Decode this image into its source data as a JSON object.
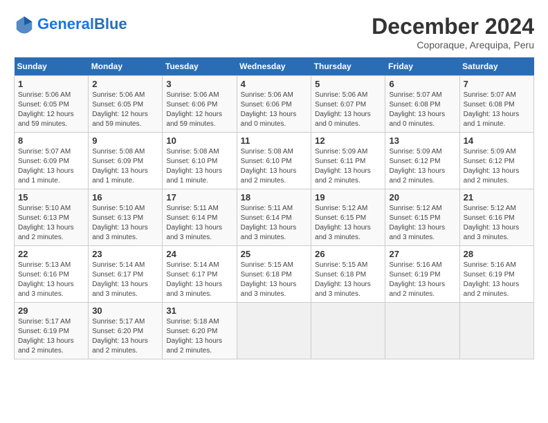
{
  "header": {
    "logo_general": "General",
    "logo_blue": "Blue",
    "month_title": "December 2024",
    "location": "Coporaque, Arequipa, Peru"
  },
  "calendar": {
    "days_of_week": [
      "Sunday",
      "Monday",
      "Tuesday",
      "Wednesday",
      "Thursday",
      "Friday",
      "Saturday"
    ],
    "weeks": [
      [
        {
          "num": "",
          "info": ""
        },
        {
          "num": "2",
          "info": "Sunrise: 5:06 AM\nSunset: 6:05 PM\nDaylight: 12 hours and 59 minutes."
        },
        {
          "num": "3",
          "info": "Sunrise: 5:06 AM\nSunset: 6:06 PM\nDaylight: 12 hours and 59 minutes."
        },
        {
          "num": "4",
          "info": "Sunrise: 5:06 AM\nSunset: 6:06 PM\nDaylight: 13 hours and 0 minutes."
        },
        {
          "num": "5",
          "info": "Sunrise: 5:06 AM\nSunset: 6:07 PM\nDaylight: 13 hours and 0 minutes."
        },
        {
          "num": "6",
          "info": "Sunrise: 5:07 AM\nSunset: 6:08 PM\nDaylight: 13 hours and 0 minutes."
        },
        {
          "num": "7",
          "info": "Sunrise: 5:07 AM\nSunset: 6:08 PM\nDaylight: 13 hours and 1 minute."
        }
      ],
      [
        {
          "num": "1",
          "info": "Sunrise: 5:06 AM\nSunset: 6:05 PM\nDaylight: 12 hours and 59 minutes.",
          "is_first_row_sunday": true
        },
        {
          "num": "9",
          "info": "Sunrise: 5:08 AM\nSunset: 6:09 PM\nDaylight: 13 hours and 1 minute."
        },
        {
          "num": "10",
          "info": "Sunrise: 5:08 AM\nSunset: 6:10 PM\nDaylight: 13 hours and 1 minute."
        },
        {
          "num": "11",
          "info": "Sunrise: 5:08 AM\nSunset: 6:10 PM\nDaylight: 13 hours and 2 minutes."
        },
        {
          "num": "12",
          "info": "Sunrise: 5:09 AM\nSunset: 6:11 PM\nDaylight: 13 hours and 2 minutes."
        },
        {
          "num": "13",
          "info": "Sunrise: 5:09 AM\nSunset: 6:12 PM\nDaylight: 13 hours and 2 minutes."
        },
        {
          "num": "14",
          "info": "Sunrise: 5:09 AM\nSunset: 6:12 PM\nDaylight: 13 hours and 2 minutes."
        }
      ],
      [
        {
          "num": "8",
          "info": "Sunrise: 5:07 AM\nSunset: 6:09 PM\nDaylight: 13 hours and 1 minute."
        },
        {
          "num": "16",
          "info": "Sunrise: 5:10 AM\nSunset: 6:13 PM\nDaylight: 13 hours and 3 minutes."
        },
        {
          "num": "17",
          "info": "Sunrise: 5:11 AM\nSunset: 6:14 PM\nDaylight: 13 hours and 3 minutes."
        },
        {
          "num": "18",
          "info": "Sunrise: 5:11 AM\nSunset: 6:14 PM\nDaylight: 13 hours and 3 minutes."
        },
        {
          "num": "19",
          "info": "Sunrise: 5:12 AM\nSunset: 6:15 PM\nDaylight: 13 hours and 3 minutes."
        },
        {
          "num": "20",
          "info": "Sunrise: 5:12 AM\nSunset: 6:15 PM\nDaylight: 13 hours and 3 minutes."
        },
        {
          "num": "21",
          "info": "Sunrise: 5:12 AM\nSunset: 6:16 PM\nDaylight: 13 hours and 3 minutes."
        }
      ],
      [
        {
          "num": "15",
          "info": "Sunrise: 5:10 AM\nSunset: 6:13 PM\nDaylight: 13 hours and 2 minutes."
        },
        {
          "num": "23",
          "info": "Sunrise: 5:14 AM\nSunset: 6:17 PM\nDaylight: 13 hours and 3 minutes."
        },
        {
          "num": "24",
          "info": "Sunrise: 5:14 AM\nSunset: 6:17 PM\nDaylight: 13 hours and 3 minutes."
        },
        {
          "num": "25",
          "info": "Sunrise: 5:15 AM\nSunset: 6:18 PM\nDaylight: 13 hours and 3 minutes."
        },
        {
          "num": "26",
          "info": "Sunrise: 5:15 AM\nSunset: 6:18 PM\nDaylight: 13 hours and 3 minutes."
        },
        {
          "num": "27",
          "info": "Sunrise: 5:16 AM\nSunset: 6:19 PM\nDaylight: 13 hours and 2 minutes."
        },
        {
          "num": "28",
          "info": "Sunrise: 5:16 AM\nSunset: 6:19 PM\nDaylight: 13 hours and 2 minutes."
        }
      ],
      [
        {
          "num": "22",
          "info": "Sunrise: 5:13 AM\nSunset: 6:16 PM\nDaylight: 13 hours and 3 minutes."
        },
        {
          "num": "30",
          "info": "Sunrise: 5:17 AM\nSunset: 6:20 PM\nDaylight: 13 hours and 2 minutes."
        },
        {
          "num": "31",
          "info": "Sunrise: 5:18 AM\nSunset: 6:20 PM\nDaylight: 13 hours and 2 minutes."
        },
        {
          "num": "",
          "info": ""
        },
        {
          "num": "",
          "info": ""
        },
        {
          "num": "",
          "info": ""
        },
        {
          "num": "",
          "info": ""
        }
      ],
      [
        {
          "num": "29",
          "info": "Sunrise: 5:17 AM\nSunset: 6:19 PM\nDaylight: 13 hours and 2 minutes."
        },
        {
          "num": "",
          "info": ""
        },
        {
          "num": "",
          "info": ""
        },
        {
          "num": "",
          "info": ""
        },
        {
          "num": "",
          "info": ""
        },
        {
          "num": "",
          "info": ""
        },
        {
          "num": "",
          "info": ""
        }
      ]
    ]
  }
}
